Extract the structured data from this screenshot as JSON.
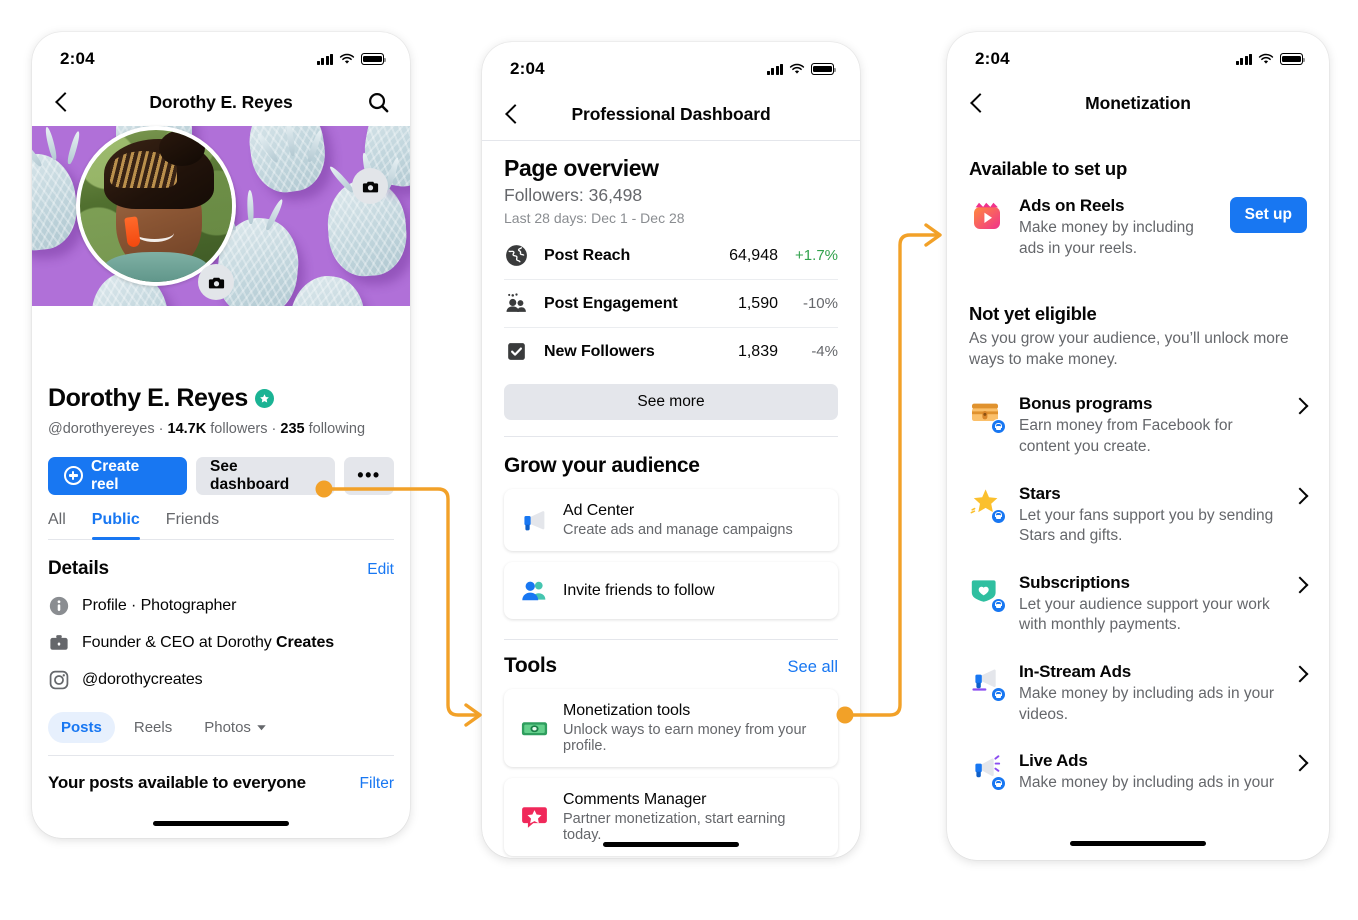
{
  "statusbar": {
    "time": "2:04"
  },
  "phone1": {
    "nav": {
      "title": "Dorothy E. Reyes",
      "back_icon": "chevron-left-icon",
      "search_icon": "search-icon"
    },
    "cover": {
      "camera_icon": "camera-icon"
    },
    "avatar": {
      "camera_icon": "camera-icon"
    },
    "profile": {
      "name": "Dorothy E. Reyes",
      "verified_icon": "verified-star-badge-icon",
      "handle": "@dorothyereyes",
      "followers_count": "14.7K",
      "followers_label": "followers",
      "following_count": "235",
      "following_label": "following",
      "sep": "·"
    },
    "buttons": {
      "create_reel": "Create reel",
      "see_dashboard": "See dashboard",
      "more": "•••"
    },
    "audience_tabs": [
      {
        "label": "All",
        "active": false
      },
      {
        "label": "Public",
        "active": true
      },
      {
        "label": "Friends",
        "active": false
      }
    ],
    "details": {
      "title": "Details",
      "edit": "Edit",
      "rows": [
        {
          "icon": "info-circle-icon",
          "text": "Profile · Photographer",
          "bold_tail": ""
        },
        {
          "icon": "briefcase-icon",
          "text": "Founder & CEO at Dorothy ",
          "bold_tail": "Creates"
        },
        {
          "icon": "instagram-icon",
          "text": "@dorothycreates",
          "bold_tail": ""
        }
      ]
    },
    "content_chips": [
      {
        "label": "Posts",
        "active": true,
        "caret": false
      },
      {
        "label": "Reels",
        "active": false,
        "caret": false
      },
      {
        "label": "Photos",
        "active": false,
        "caret": true
      }
    ],
    "posts": {
      "title": "Your posts available to everyone",
      "filter": "Filter"
    }
  },
  "phone2": {
    "nav": {
      "title": "Professional Dashboard",
      "back_icon": "chevron-left-icon"
    },
    "overview": {
      "title": "Page overview",
      "followers": "Followers: 36,498",
      "range": "Last 28 days: Dec 1 - Dec 28",
      "stats": [
        {
          "icon": "globe-icon",
          "label": "Post Reach",
          "value": "64,948",
          "delta": "+1.7%",
          "direction": "up"
        },
        {
          "icon": "people-icon",
          "label": "Post Engagement",
          "value": "1,590",
          "delta": "-10%",
          "direction": "down"
        },
        {
          "icon": "check-badge-icon",
          "label": "New Followers",
          "value": "1,839",
          "delta": "-4%",
          "direction": "down"
        }
      ],
      "see_more": "See more"
    },
    "grow": {
      "title": "Grow your audience",
      "cards": [
        {
          "icon": "megaphone-icon",
          "title": "Ad Center",
          "subtitle": "Create ads and manage campaigns"
        },
        {
          "icon": "friends-icon",
          "title": "Invite friends to follow",
          "subtitle": ""
        }
      ]
    },
    "tools": {
      "title": "Tools",
      "see_all": "See all",
      "cards": [
        {
          "icon": "money-icon",
          "title": "Monetization tools",
          "subtitle": "Unlock ways to earn money from your profile."
        },
        {
          "icon": "comment-star-icon",
          "title": "Comments Manager",
          "subtitle": "Partner monetization, start earning today."
        }
      ]
    }
  },
  "phone3": {
    "nav": {
      "title": "Monetization",
      "back_icon": "chevron-left-icon"
    },
    "available": {
      "title": "Available to set up",
      "items": [
        {
          "icon": "reels-icon",
          "title": "Ads on Reels",
          "desc": "Make money by including ads in your reels.",
          "action": "Set up"
        }
      ]
    },
    "not_eligible": {
      "title": "Not yet eligible",
      "subtitle": "As you grow your audience, you’ll unlock more ways to make money.",
      "items": [
        {
          "icon": "treasure-chest-icon",
          "title": "Bonus programs",
          "desc": "Earn money from Facebook for content you create."
        },
        {
          "icon": "star-icon",
          "title": "Stars",
          "desc": "Let your fans support you by sending Stars and gifts."
        },
        {
          "icon": "heart-shield-icon",
          "title": "Subscriptions",
          "desc": "Let your audience support your work with monthly payments."
        },
        {
          "icon": "megaphone-video-icon",
          "title": "In-Stream Ads",
          "desc": "Make money by including ads in your videos."
        },
        {
          "icon": "megaphone-live-icon",
          "title": "Live Ads",
          "desc": "Make money by including ads in your"
        }
      ]
    }
  },
  "colors": {
    "facebook_blue": "#1877F2",
    "connector_orange": "#F2A128",
    "positive_green": "#31A24C",
    "cover_purple": "#B070D8",
    "verified_teal": "#1AB394"
  }
}
